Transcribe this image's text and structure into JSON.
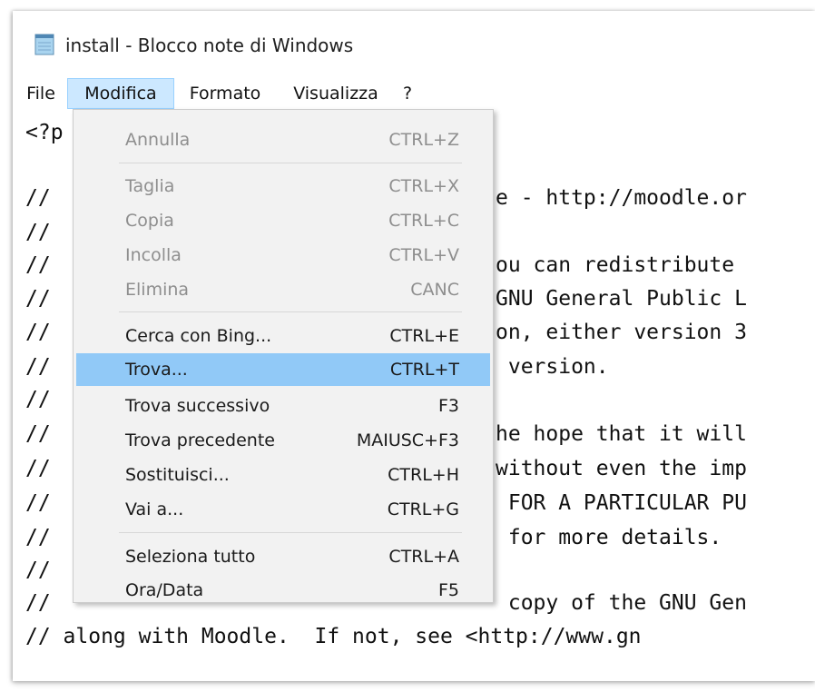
{
  "window": {
    "title": "install - Blocco note di Windows",
    "icon": "notepad-icon"
  },
  "menubar": {
    "items": [
      {
        "label": "File"
      },
      {
        "label": "Modifica"
      },
      {
        "label": "Formato"
      },
      {
        "label": "Visualizza"
      },
      {
        "label": "?"
      }
    ],
    "active": "Modifica"
  },
  "editor": {
    "lines": [
      {
        "left": "<?p",
        "right": ""
      },
      {
        "left": "",
        "right": ""
      },
      {
        "left": "//",
        "right": "e - http://moodle.or"
      },
      {
        "left": "//",
        "right": ""
      },
      {
        "left": "//",
        "right": "ou can redistribute"
      },
      {
        "left": "//",
        "right": "GNU General Public L"
      },
      {
        "left": "//",
        "right": "on, either version 3"
      },
      {
        "left": "//",
        "right": " version."
      },
      {
        "left": "//",
        "right": ""
      },
      {
        "left": "//",
        "right": "he hope that it will"
      },
      {
        "left": "//",
        "right": "without even the imp"
      },
      {
        "left": "//",
        "right": " FOR A PARTICULAR PU"
      },
      {
        "left": "//",
        "right": " for more details."
      },
      {
        "left": "//",
        "right": ""
      },
      {
        "left": "//",
        "right": " copy of the GNU Gen"
      },
      {
        "full": "// along with Moodle.  If not, see <http://www.gn"
      }
    ]
  },
  "dropdown": {
    "items": [
      {
        "label": "Annulla",
        "shortcut": "CTRL+Z",
        "enabled": false
      },
      {
        "label": "Taglia",
        "shortcut": "CTRL+X",
        "enabled": false
      },
      {
        "label": "Copia",
        "shortcut": "CTRL+C",
        "enabled": false
      },
      {
        "label": "Incolla",
        "shortcut": "CTRL+V",
        "enabled": false
      },
      {
        "label": "Elimina",
        "shortcut": "CANC",
        "enabled": false
      },
      {
        "label": "Cerca con Bing...",
        "shortcut": "CTRL+E",
        "enabled": true
      },
      {
        "label": "Trova...",
        "shortcut": "CTRL+T",
        "enabled": true,
        "highlighted": true
      },
      {
        "label": "Trova successivo",
        "shortcut": "F3",
        "enabled": true
      },
      {
        "label": "Trova precedente",
        "shortcut": "MAIUSC+F3",
        "enabled": true
      },
      {
        "label": "Sostituisci...",
        "shortcut": "CTRL+H",
        "enabled": true
      },
      {
        "label": "Vai a...",
        "shortcut": "CTRL+G",
        "enabled": true
      },
      {
        "label": "Seleziona tutto",
        "shortcut": "CTRL+A",
        "enabled": true
      },
      {
        "label": "Ora/Data",
        "shortcut": "F5",
        "enabled": true
      }
    ]
  },
  "colors": {
    "menu_active_bg": "#cce8ff",
    "menu_highlight_bg": "#91c9f7",
    "disabled_text": "#8e8e8e"
  }
}
